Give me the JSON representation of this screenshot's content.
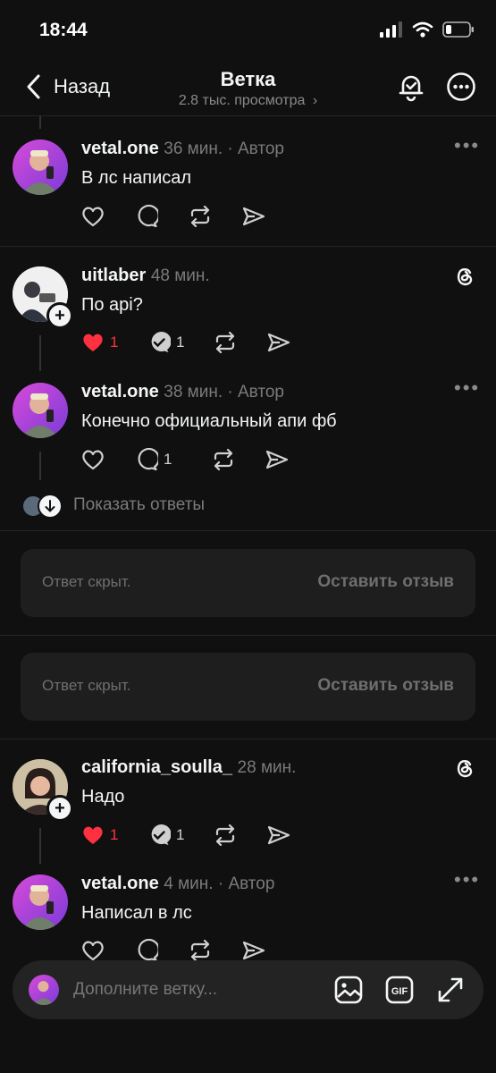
{
  "status": {
    "time": "18:44"
  },
  "nav": {
    "back_label": "Назад",
    "title": "Ветка",
    "views": "2.8 тыс. просмотра"
  },
  "posts": [
    {
      "username": "vetal.one",
      "meta": "36 мин. · Автор",
      "text": "В лс написал",
      "likes": "",
      "replies": ""
    },
    {
      "username": "uitlaber",
      "meta": "48 мин.",
      "text": "По api?",
      "likes": "1",
      "replies": "1"
    },
    {
      "username": "vetal.one",
      "meta": "38 мин. · Автор",
      "text": "Конечно официальный апи фб",
      "likes": "",
      "replies": "1"
    },
    {
      "username": "california_soulla_",
      "meta": "28 мин.",
      "text": "Надо",
      "likes": "1",
      "replies": "1"
    },
    {
      "username": "vetal.one",
      "meta": "4 мин. · Автор",
      "text": "Написал в лс",
      "likes": "",
      "replies": ""
    }
  ],
  "show_replies": "Показать ответы",
  "hidden_replies": [
    {
      "text": "Ответ скрыт.",
      "action": "Оставить отзыв"
    },
    {
      "text": "Ответ скрыт.",
      "action": "Оставить отзыв"
    }
  ],
  "composer": {
    "placeholder": "Дополните ветку..."
  },
  "colors": {
    "background": "#101010",
    "like_red": "#ff3040",
    "muted": "#7a7a7a",
    "box": "#1e1e1e"
  },
  "icons": [
    "back-icon",
    "bell-check-icon",
    "more-icon",
    "heart-icon",
    "comment-icon",
    "repost-icon",
    "share-icon",
    "threads-logo-icon",
    "image-icon",
    "gif-icon",
    "expand-icon"
  ]
}
